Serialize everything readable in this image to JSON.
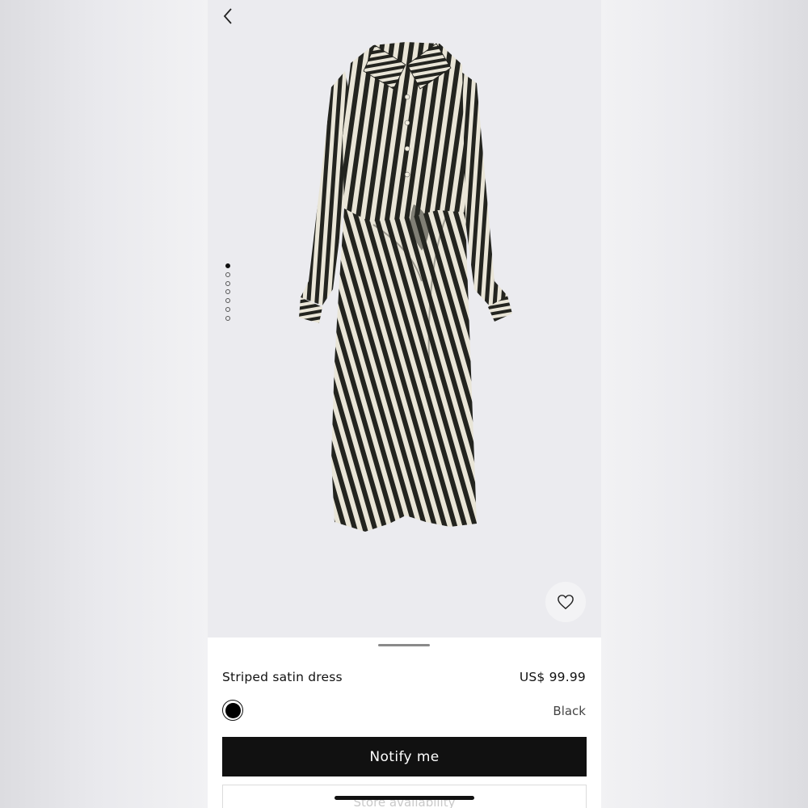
{
  "nav": {
    "back_icon": "chevron-left-icon"
  },
  "gallery": {
    "image_count": 7,
    "active_index": 0,
    "favorite_icon": "heart-icon"
  },
  "product": {
    "name": "Striped satin dress",
    "price": "US$ 99.99",
    "color_name": "Black",
    "color_hex": "#000000"
  },
  "actions": {
    "notify_label": "Notify me",
    "store_label": "Store availability"
  },
  "colors": {
    "accent": "#111111",
    "image_background": "#ebebef"
  }
}
